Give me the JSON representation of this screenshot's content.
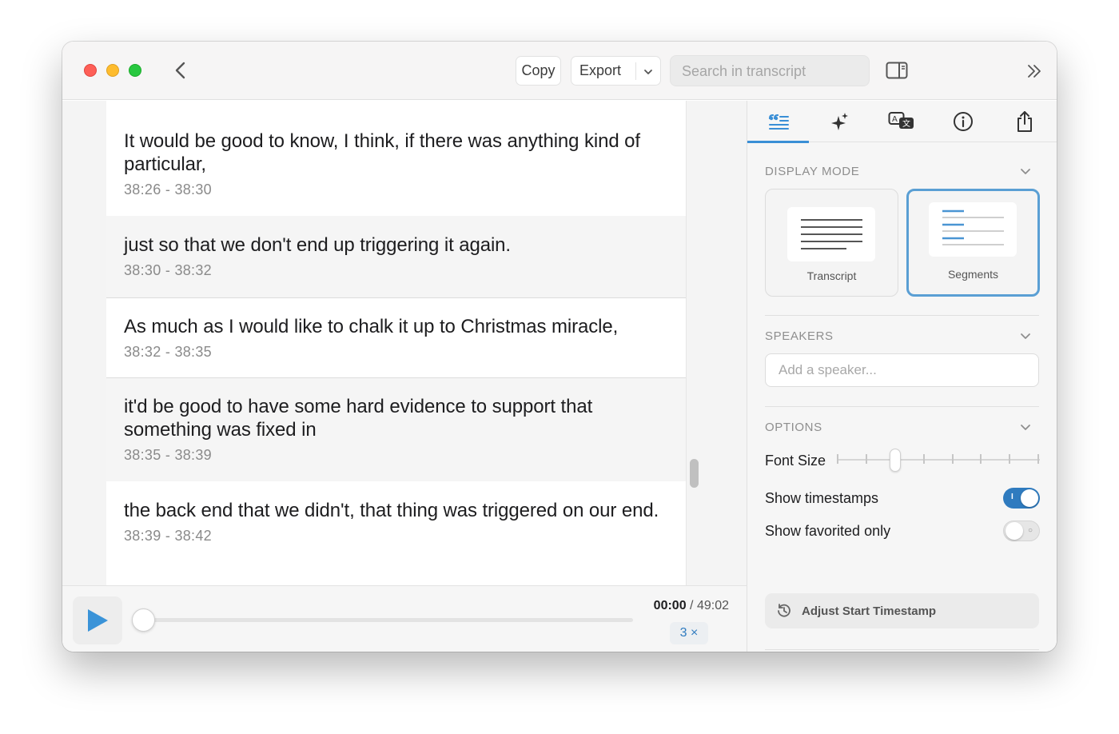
{
  "toolbar": {
    "copy_label": "Copy",
    "export_label": "Export",
    "search_placeholder": "Search in transcript"
  },
  "segments": [
    {
      "text": "It would be good to know, I think, if there was anything kind of particular,",
      "time": "38:26 - 38:30"
    },
    {
      "text": "just so that we don't end up triggering it again.",
      "time": "38:30 - 38:32"
    },
    {
      "text": "As much as I would like to chalk it up to Christmas miracle,",
      "time": "38:32 - 38:35"
    },
    {
      "text": "it'd be good to have some hard evidence to support that something was fixed in",
      "time": "38:35 - 38:39"
    },
    {
      "text": "the back end that we didn't, that thing was triggered on our end.",
      "time": "38:39 - 38:42"
    }
  ],
  "player": {
    "current_time": "00:00",
    "separator": "/",
    "duration": "49:02",
    "speed": "3 ×",
    "progress": 0
  },
  "sidebar": {
    "tabs": [
      {
        "name": "quote-icon",
        "active": true
      },
      {
        "name": "sparkles-icon",
        "active": false
      },
      {
        "name": "translate-icon",
        "active": false
      },
      {
        "name": "info-icon",
        "active": false
      },
      {
        "name": "share-icon",
        "active": false
      }
    ],
    "display_mode": {
      "heading": "DISPLAY MODE",
      "options": [
        "Transcript",
        "Segments"
      ],
      "selected": "Segments"
    },
    "speakers": {
      "heading": "SPEAKERS",
      "placeholder": "Add a speaker..."
    },
    "options": {
      "heading": "OPTIONS",
      "font_size_label": "Font Size",
      "font_size_level": 3,
      "font_size_steps": 8,
      "show_timestamps_label": "Show timestamps",
      "show_timestamps": true,
      "show_favorited_label": "Show favorited only",
      "show_favorited": false,
      "adjust_label": "Adjust Start Timestamp"
    }
  },
  "colors": {
    "accent": "#2f7bbf",
    "selected_border": "#5a9fd4",
    "traffic_red": "#fe5f57",
    "traffic_yellow": "#febc2e",
    "traffic_green": "#28c840"
  }
}
